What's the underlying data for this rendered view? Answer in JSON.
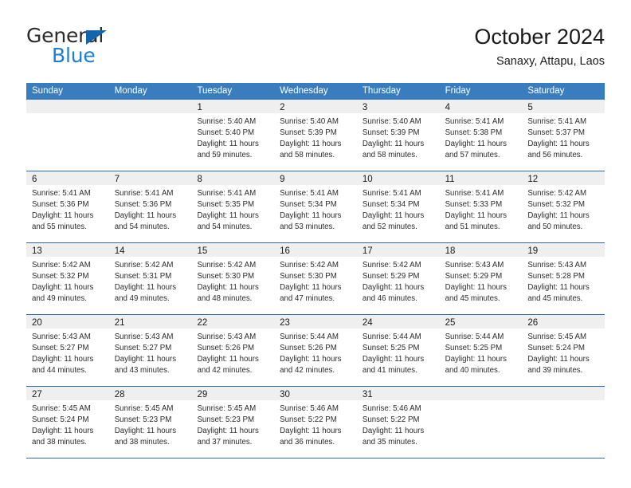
{
  "logo": {
    "word_top": "General",
    "word_bottom": "Blue",
    "triangle_color": "#1464ae",
    "blue_color": "#1a7fd4"
  },
  "header": {
    "title": "October 2024",
    "subtitle": "Sanaxy, Attapu, Laos"
  },
  "theme": {
    "header_row_bg": "#3a7dbf",
    "row_separator": "#2f6aa8",
    "day_band_bg": "#efefef"
  },
  "weekdays": [
    "Sunday",
    "Monday",
    "Tuesday",
    "Wednesday",
    "Thursday",
    "Friday",
    "Saturday"
  ],
  "weeks": [
    [
      {
        "num": "",
        "sunrise": "",
        "sunset": "",
        "daylight1": "",
        "daylight2": ""
      },
      {
        "num": "",
        "sunrise": "",
        "sunset": "",
        "daylight1": "",
        "daylight2": ""
      },
      {
        "num": "1",
        "sunrise": "Sunrise: 5:40 AM",
        "sunset": "Sunset: 5:40 PM",
        "daylight1": "Daylight: 11 hours",
        "daylight2": "and 59 minutes."
      },
      {
        "num": "2",
        "sunrise": "Sunrise: 5:40 AM",
        "sunset": "Sunset: 5:39 PM",
        "daylight1": "Daylight: 11 hours",
        "daylight2": "and 58 minutes."
      },
      {
        "num": "3",
        "sunrise": "Sunrise: 5:40 AM",
        "sunset": "Sunset: 5:39 PM",
        "daylight1": "Daylight: 11 hours",
        "daylight2": "and 58 minutes."
      },
      {
        "num": "4",
        "sunrise": "Sunrise: 5:41 AM",
        "sunset": "Sunset: 5:38 PM",
        "daylight1": "Daylight: 11 hours",
        "daylight2": "and 57 minutes."
      },
      {
        "num": "5",
        "sunrise": "Sunrise: 5:41 AM",
        "sunset": "Sunset: 5:37 PM",
        "daylight1": "Daylight: 11 hours",
        "daylight2": "and 56 minutes."
      }
    ],
    [
      {
        "num": "6",
        "sunrise": "Sunrise: 5:41 AM",
        "sunset": "Sunset: 5:36 PM",
        "daylight1": "Daylight: 11 hours",
        "daylight2": "and 55 minutes."
      },
      {
        "num": "7",
        "sunrise": "Sunrise: 5:41 AM",
        "sunset": "Sunset: 5:36 PM",
        "daylight1": "Daylight: 11 hours",
        "daylight2": "and 54 minutes."
      },
      {
        "num": "8",
        "sunrise": "Sunrise: 5:41 AM",
        "sunset": "Sunset: 5:35 PM",
        "daylight1": "Daylight: 11 hours",
        "daylight2": "and 54 minutes."
      },
      {
        "num": "9",
        "sunrise": "Sunrise: 5:41 AM",
        "sunset": "Sunset: 5:34 PM",
        "daylight1": "Daylight: 11 hours",
        "daylight2": "and 53 minutes."
      },
      {
        "num": "10",
        "sunrise": "Sunrise: 5:41 AM",
        "sunset": "Sunset: 5:34 PM",
        "daylight1": "Daylight: 11 hours",
        "daylight2": "and 52 minutes."
      },
      {
        "num": "11",
        "sunrise": "Sunrise: 5:41 AM",
        "sunset": "Sunset: 5:33 PM",
        "daylight1": "Daylight: 11 hours",
        "daylight2": "and 51 minutes."
      },
      {
        "num": "12",
        "sunrise": "Sunrise: 5:42 AM",
        "sunset": "Sunset: 5:32 PM",
        "daylight1": "Daylight: 11 hours",
        "daylight2": "and 50 minutes."
      }
    ],
    [
      {
        "num": "13",
        "sunrise": "Sunrise: 5:42 AM",
        "sunset": "Sunset: 5:32 PM",
        "daylight1": "Daylight: 11 hours",
        "daylight2": "and 49 minutes."
      },
      {
        "num": "14",
        "sunrise": "Sunrise: 5:42 AM",
        "sunset": "Sunset: 5:31 PM",
        "daylight1": "Daylight: 11 hours",
        "daylight2": "and 49 minutes."
      },
      {
        "num": "15",
        "sunrise": "Sunrise: 5:42 AM",
        "sunset": "Sunset: 5:30 PM",
        "daylight1": "Daylight: 11 hours",
        "daylight2": "and 48 minutes."
      },
      {
        "num": "16",
        "sunrise": "Sunrise: 5:42 AM",
        "sunset": "Sunset: 5:30 PM",
        "daylight1": "Daylight: 11 hours",
        "daylight2": "and 47 minutes."
      },
      {
        "num": "17",
        "sunrise": "Sunrise: 5:42 AM",
        "sunset": "Sunset: 5:29 PM",
        "daylight1": "Daylight: 11 hours",
        "daylight2": "and 46 minutes."
      },
      {
        "num": "18",
        "sunrise": "Sunrise: 5:43 AM",
        "sunset": "Sunset: 5:29 PM",
        "daylight1": "Daylight: 11 hours",
        "daylight2": "and 45 minutes."
      },
      {
        "num": "19",
        "sunrise": "Sunrise: 5:43 AM",
        "sunset": "Sunset: 5:28 PM",
        "daylight1": "Daylight: 11 hours",
        "daylight2": "and 45 minutes."
      }
    ],
    [
      {
        "num": "20",
        "sunrise": "Sunrise: 5:43 AM",
        "sunset": "Sunset: 5:27 PM",
        "daylight1": "Daylight: 11 hours",
        "daylight2": "and 44 minutes."
      },
      {
        "num": "21",
        "sunrise": "Sunrise: 5:43 AM",
        "sunset": "Sunset: 5:27 PM",
        "daylight1": "Daylight: 11 hours",
        "daylight2": "and 43 minutes."
      },
      {
        "num": "22",
        "sunrise": "Sunrise: 5:43 AM",
        "sunset": "Sunset: 5:26 PM",
        "daylight1": "Daylight: 11 hours",
        "daylight2": "and 42 minutes."
      },
      {
        "num": "23",
        "sunrise": "Sunrise: 5:44 AM",
        "sunset": "Sunset: 5:26 PM",
        "daylight1": "Daylight: 11 hours",
        "daylight2": "and 42 minutes."
      },
      {
        "num": "24",
        "sunrise": "Sunrise: 5:44 AM",
        "sunset": "Sunset: 5:25 PM",
        "daylight1": "Daylight: 11 hours",
        "daylight2": "and 41 minutes."
      },
      {
        "num": "25",
        "sunrise": "Sunrise: 5:44 AM",
        "sunset": "Sunset: 5:25 PM",
        "daylight1": "Daylight: 11 hours",
        "daylight2": "and 40 minutes."
      },
      {
        "num": "26",
        "sunrise": "Sunrise: 5:45 AM",
        "sunset": "Sunset: 5:24 PM",
        "daylight1": "Daylight: 11 hours",
        "daylight2": "and 39 minutes."
      }
    ],
    [
      {
        "num": "27",
        "sunrise": "Sunrise: 5:45 AM",
        "sunset": "Sunset: 5:24 PM",
        "daylight1": "Daylight: 11 hours",
        "daylight2": "and 38 minutes."
      },
      {
        "num": "28",
        "sunrise": "Sunrise: 5:45 AM",
        "sunset": "Sunset: 5:23 PM",
        "daylight1": "Daylight: 11 hours",
        "daylight2": "and 38 minutes."
      },
      {
        "num": "29",
        "sunrise": "Sunrise: 5:45 AM",
        "sunset": "Sunset: 5:23 PM",
        "daylight1": "Daylight: 11 hours",
        "daylight2": "and 37 minutes."
      },
      {
        "num": "30",
        "sunrise": "Sunrise: 5:46 AM",
        "sunset": "Sunset: 5:22 PM",
        "daylight1": "Daylight: 11 hours",
        "daylight2": "and 36 minutes."
      },
      {
        "num": "31",
        "sunrise": "Sunrise: 5:46 AM",
        "sunset": "Sunset: 5:22 PM",
        "daylight1": "Daylight: 11 hours",
        "daylight2": "and 35 minutes."
      },
      {
        "num": "",
        "sunrise": "",
        "sunset": "",
        "daylight1": "",
        "daylight2": ""
      },
      {
        "num": "",
        "sunrise": "",
        "sunset": "",
        "daylight1": "",
        "daylight2": ""
      }
    ]
  ]
}
